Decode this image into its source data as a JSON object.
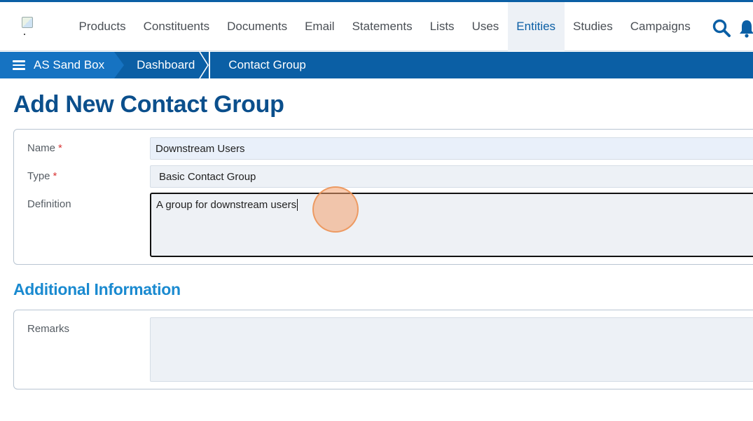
{
  "nav": {
    "items": [
      "Products",
      "Constituents",
      "Documents",
      "Email",
      "Statements",
      "Lists",
      "Uses",
      "Entities",
      "Studies",
      "Campaigns"
    ],
    "active": "Entities"
  },
  "breadcrumb": {
    "home": "AS Sand Box",
    "dashboard": "Dashboard",
    "current": "Contact Group"
  },
  "page": {
    "title": "Add New Contact Group"
  },
  "form": {
    "name_label": "Name",
    "name_value": "Downstream Users",
    "type_label": "Type",
    "type_value": "Basic Contact Group",
    "definition_label": "Definition",
    "definition_value": "A group for downstream users",
    "required_mark": "*"
  },
  "additional": {
    "title": "Additional Information",
    "remarks_label": "Remarks",
    "remarks_value": ""
  },
  "colors": {
    "brand": "#0b5fa5",
    "title": "#0b4f8c",
    "section": "#1a8ad0",
    "required": "#d93636"
  },
  "icons": {
    "logo": "broken-image-icon",
    "menu": "hamburger-icon",
    "search": "search-icon",
    "notifications": "bell-icon"
  }
}
